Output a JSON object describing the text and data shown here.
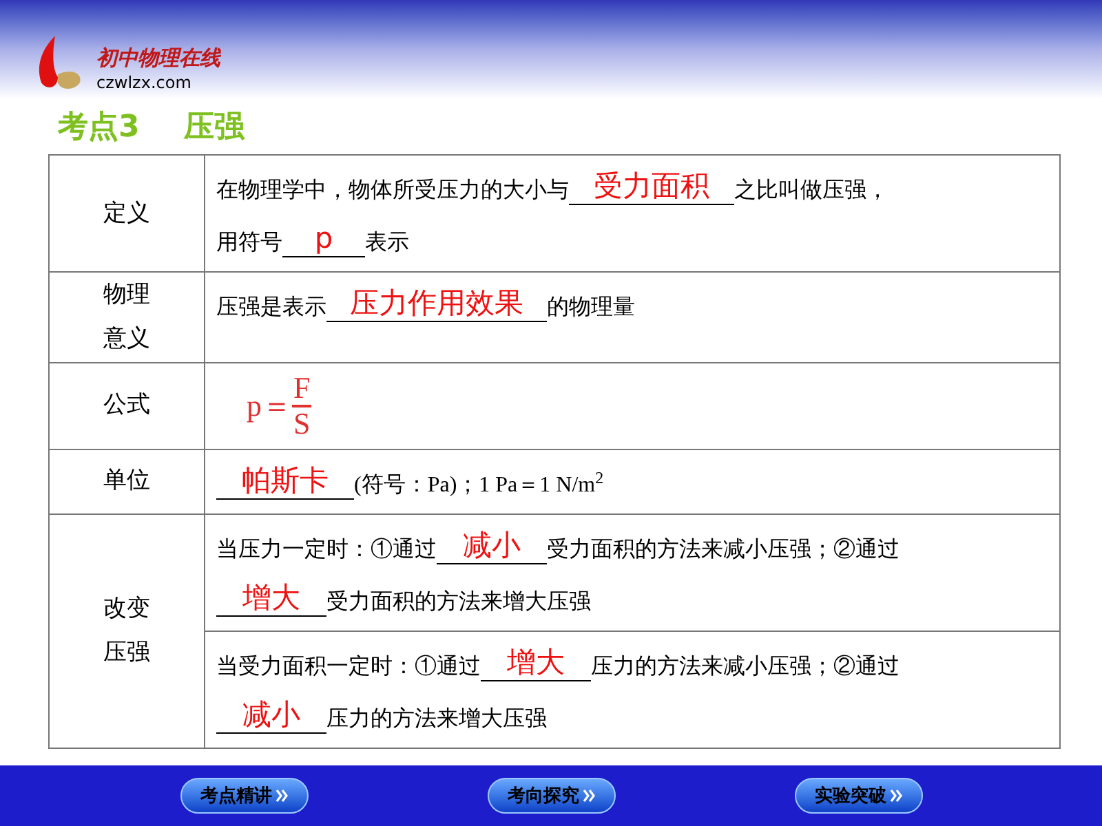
{
  "logo": {
    "title": "初中物理在线",
    "site": "czwlzx.com"
  },
  "heading": {
    "number": "考点3",
    "topic": "压强"
  },
  "rows": [
    {
      "kind": "lines",
      "label": "定义",
      "lines": [
        [
          {
            "kind": "text",
            "text": "在物理学中，物体所受压力的大小与"
          },
          {
            "kind": "blank",
            "answer": "受力面积"
          },
          {
            "kind": "text",
            "text": "之比叫做压强，"
          }
        ],
        [
          {
            "kind": "text",
            "text": "用符号"
          },
          {
            "kind": "blank",
            "answer": "p"
          },
          {
            "kind": "text",
            "text": "表示"
          }
        ]
      ]
    },
    {
      "kind": "lines",
      "label": "物理意义",
      "lines": [
        [
          {
            "kind": "text",
            "text": "压强是表示"
          },
          {
            "kind": "blank",
            "answer": "压力作用效果"
          },
          {
            "kind": "text",
            "text": "的物理量"
          }
        ]
      ]
    },
    {
      "kind": "formula",
      "label": "公式",
      "formula": {
        "lhs": "p＝",
        "numerator": "F",
        "denominator": "S"
      }
    },
    {
      "kind": "lines",
      "label": "单位",
      "lines": [
        [
          {
            "kind": "blank",
            "answer": "帕斯卡"
          },
          {
            "kind": "text",
            "text": "(符号：Pa)；1 Pa＝1 N/m$^{2}$"
          }
        ]
      ]
    },
    {
      "kind": "group",
      "label": "改变压强",
      "parts": [
        {
          "lines": [
            [
              {
                "kind": "text",
                "text": "当压力一定时：①通过"
              },
              {
                "kind": "blank",
                "answer": "减小"
              },
              {
                "kind": "text",
                "text": "受力面积的方法来减小压强；②通过"
              }
            ],
            [
              {
                "kind": "blank",
                "answer": "增大"
              },
              {
                "kind": "text",
                "text": "受力面积的方法来增大压强"
              }
            ]
          ]
        },
        {
          "lines": [
            [
              {
                "kind": "text",
                "text": "当受力面积一定时：①通过"
              },
              {
                "kind": "blank",
                "answer": "增大"
              },
              {
                "kind": "text",
                "text": "压力的方法来减小压强；②通过"
              }
            ],
            [
              {
                "kind": "blank",
                "answer": "减小"
              },
              {
                "kind": "text",
                "text": "压力的方法来增大压强"
              }
            ]
          ]
        }
      ]
    }
  ],
  "nav_buttons": [
    "考点精讲",
    "考向探究",
    "实验突破"
  ]
}
